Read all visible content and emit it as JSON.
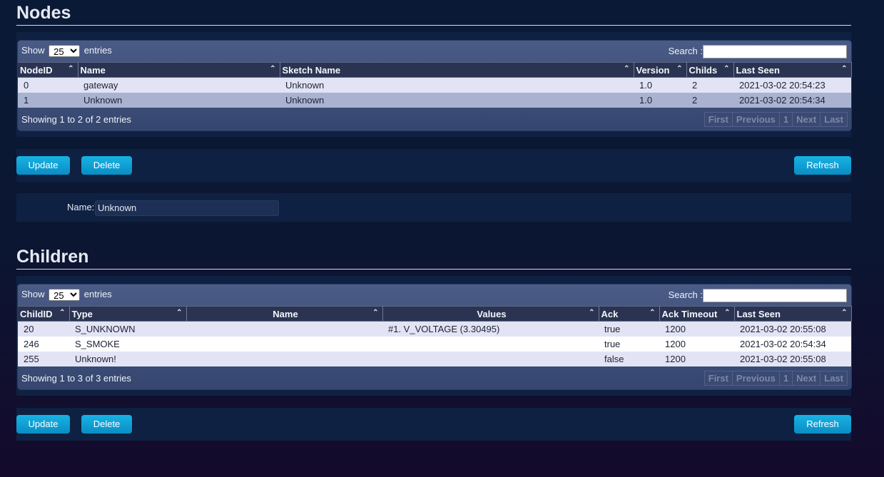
{
  "nodes": {
    "title": "Nodes",
    "show_prefix": "Show",
    "show_value": "25",
    "show_suffix": "entries",
    "search_label": "Search :",
    "columns": [
      "NodeID",
      "Name",
      "Sketch Name",
      "Version",
      "Childs",
      "Last Seen"
    ],
    "rows": [
      [
        "0",
        "gateway",
        "Unknown",
        "1.0",
        "2",
        "2021-03-02 20:54:23"
      ],
      [
        "1",
        "Unknown",
        "Unknown",
        "1.0",
        "2",
        "2021-03-02 20:54:34"
      ]
    ],
    "info": "Showing 1 to 2 of 2 entries",
    "pager": [
      "First",
      "Previous",
      "1",
      "Next",
      "Last"
    ],
    "update_label": "Update",
    "delete_label": "Delete",
    "refresh_label": "Refresh",
    "name_label": "Name:",
    "name_value": "Unknown"
  },
  "children": {
    "title": "Children",
    "show_prefix": "Show",
    "show_value": "25",
    "show_suffix": "entries",
    "search_label": "Search :",
    "columns": [
      "ChildID",
      "Type",
      "Name",
      "Values",
      "Ack",
      "Ack Timeout",
      "Last Seen"
    ],
    "rows": [
      [
        "20",
        "S_UNKNOWN",
        "",
        "#1. V_VOLTAGE (3.30495)",
        "true",
        "1200",
        "2021-03-02 20:55:08"
      ],
      [
        "246",
        "S_SMOKE",
        "",
        "",
        "true",
        "1200",
        "2021-03-02 20:54:34"
      ],
      [
        "255",
        "Unknown!",
        "",
        "",
        "false",
        "1200",
        "2021-03-02 20:55:08"
      ]
    ],
    "info": "Showing 1 to 3 of 3 entries",
    "pager": [
      "First",
      "Previous",
      "1",
      "Next",
      "Last"
    ],
    "update_label": "Update",
    "delete_label": "Delete",
    "refresh_label": "Refresh"
  },
  "colors": {
    "button": "#0a9fd6",
    "row_odd": "#e2e4f5",
    "row_even": "#a9b3d1",
    "header": "#2a3452"
  }
}
